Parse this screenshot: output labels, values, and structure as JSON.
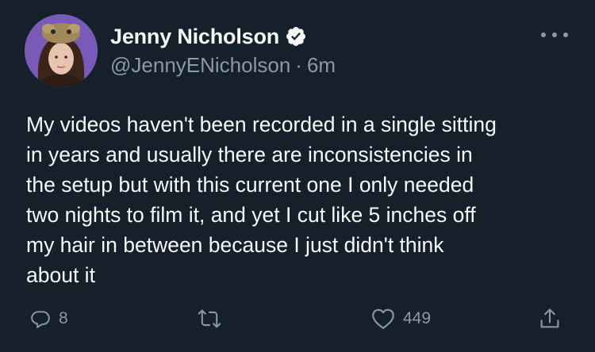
{
  "author": {
    "display_name": "Jenny Nicholson",
    "handle": "@JennyENicholson",
    "separator": "·",
    "time": "6m",
    "verified": true
  },
  "tweet": {
    "text": "My videos haven't been recorded in a single sitting\nin years and usually there are inconsistencies in\nthe setup but with this current one I only needed\ntwo nights to film it, and yet I cut like 5 inches off\nmy hair in between because I just didn't think\nabout it"
  },
  "actions": {
    "reply_count": "8",
    "retweet_count": "",
    "like_count": "449"
  },
  "icons": {
    "verified": "verified-badge-icon",
    "more": "more-options-icon",
    "reply": "reply-icon",
    "retweet": "retweet-icon",
    "like": "heart-icon",
    "share": "share-icon"
  },
  "colors": {
    "background": "#15202b",
    "text_primary": "#f7f9f9",
    "text_secondary": "#8b98a5",
    "avatar_bg": "#7a5ab8"
  }
}
